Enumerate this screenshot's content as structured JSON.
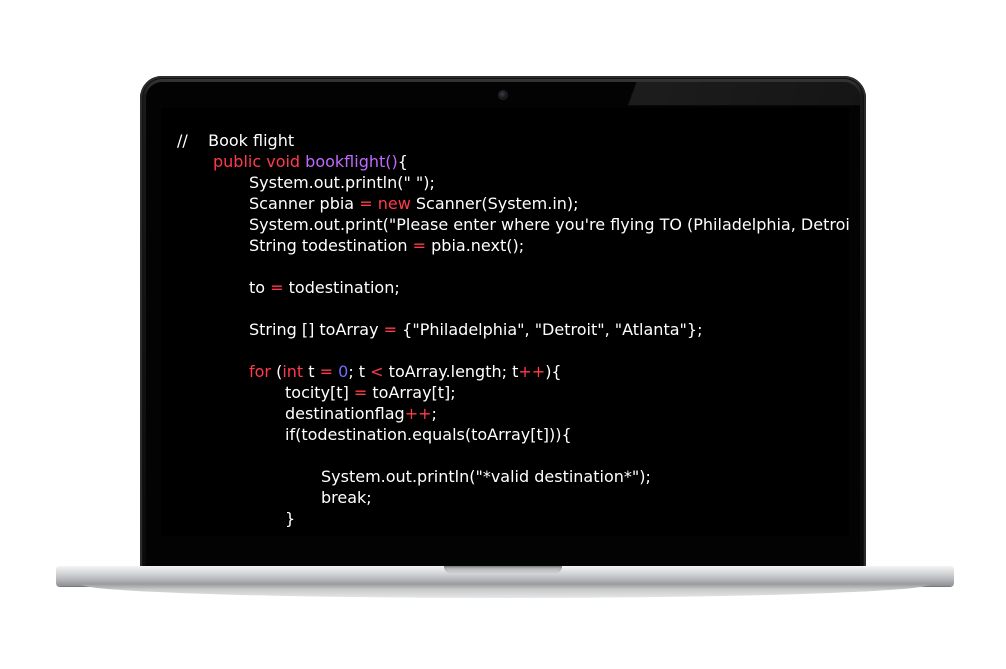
{
  "editor": {
    "lines": [
      {
        "indent": 0,
        "parts": [
          {
            "t": "//    Book flight",
            "c": "plain"
          }
        ]
      },
      {
        "indent": 1,
        "parts": [
          {
            "t": "public void ",
            "c": "kw"
          },
          {
            "t": "bookflight()",
            "c": "fn"
          },
          {
            "t": "{",
            "c": "plain"
          }
        ]
      },
      {
        "indent": 2,
        "parts": [
          {
            "t": "System.out.println(\" \");",
            "c": "plain"
          }
        ]
      },
      {
        "indent": 2,
        "parts": [
          {
            "t": "Scanner pbia ",
            "c": "plain"
          },
          {
            "t": "=",
            "c": "op"
          },
          {
            "t": " ",
            "c": "plain"
          },
          {
            "t": "new",
            "c": "kw"
          },
          {
            "t": " Scanner(System.in);",
            "c": "plain"
          }
        ]
      },
      {
        "indent": 2,
        "parts": [
          {
            "t": "System.out.print(\"Please enter where you're flying TO (Philadelphia, Detroit, Atlanta)\");",
            "c": "plain"
          }
        ]
      },
      {
        "indent": 2,
        "parts": [
          {
            "t": "String todestination ",
            "c": "plain"
          },
          {
            "t": "=",
            "c": "op"
          },
          {
            "t": " pbia.next();",
            "c": "plain"
          }
        ]
      },
      {
        "indent": 2,
        "parts": [
          {
            "t": "",
            "c": "plain"
          }
        ]
      },
      {
        "indent": 2,
        "parts": [
          {
            "t": "to ",
            "c": "plain"
          },
          {
            "t": "=",
            "c": "op"
          },
          {
            "t": " todestination;",
            "c": "plain"
          }
        ]
      },
      {
        "indent": 2,
        "parts": [
          {
            "t": "",
            "c": "plain"
          }
        ]
      },
      {
        "indent": 2,
        "parts": [
          {
            "t": "String [] toArray ",
            "c": "plain"
          },
          {
            "t": "=",
            "c": "op"
          },
          {
            "t": " {\"Philadelphia\", \"Detroit\", \"Atlanta\"};",
            "c": "plain"
          }
        ]
      },
      {
        "indent": 2,
        "parts": [
          {
            "t": "",
            "c": "plain"
          }
        ]
      },
      {
        "indent": 2,
        "parts": [
          {
            "t": "for",
            "c": "kw"
          },
          {
            "t": " (",
            "c": "plain"
          },
          {
            "t": "int",
            "c": "kw"
          },
          {
            "t": " t ",
            "c": "plain"
          },
          {
            "t": "=",
            "c": "op"
          },
          {
            "t": " ",
            "c": "plain"
          },
          {
            "t": "0",
            "c": "num"
          },
          {
            "t": "; t ",
            "c": "plain"
          },
          {
            "t": "<",
            "c": "op"
          },
          {
            "t": " toArray.length; t",
            "c": "plain"
          },
          {
            "t": "++",
            "c": "op"
          },
          {
            "t": "){",
            "c": "plain"
          }
        ]
      },
      {
        "indent": 3,
        "parts": [
          {
            "t": "tocity[t] ",
            "c": "plain"
          },
          {
            "t": "=",
            "c": "op"
          },
          {
            "t": " toArray[t];",
            "c": "plain"
          }
        ]
      },
      {
        "indent": 3,
        "parts": [
          {
            "t": "destinationflag",
            "c": "plain"
          },
          {
            "t": "++",
            "c": "op"
          },
          {
            "t": ";",
            "c": "plain"
          }
        ]
      },
      {
        "indent": 3,
        "parts": [
          {
            "t": "if(todestination.equals(toArray[t])){",
            "c": "plain"
          }
        ]
      },
      {
        "indent": 3,
        "parts": [
          {
            "t": "",
            "c": "plain"
          }
        ]
      },
      {
        "indent": 4,
        "parts": [
          {
            "t": "System.out.println(\"*valid destination*\");",
            "c": "plain"
          }
        ]
      },
      {
        "indent": 4,
        "parts": [
          {
            "t": "break;",
            "c": "plain"
          }
        ]
      },
      {
        "indent": 3,
        "parts": [
          {
            "t": "}",
            "c": "plain"
          }
        ]
      }
    ]
  },
  "colors": {
    "keyword": "#ff3b4b",
    "function": "#c069ff",
    "number": "#6e6eff",
    "text": "#ffffff",
    "background": "#000000"
  }
}
